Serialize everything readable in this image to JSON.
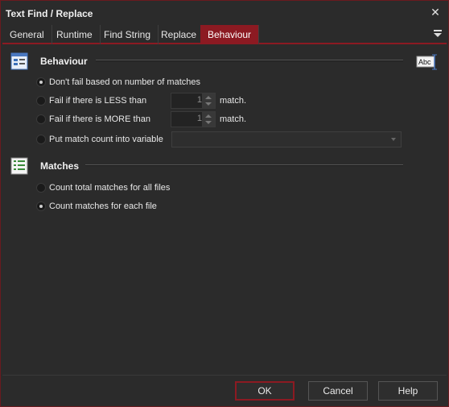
{
  "window": {
    "title": "Text Find / Replace"
  },
  "tabs": [
    {
      "label": "General"
    },
    {
      "label": "Runtime"
    },
    {
      "label": "Find String"
    },
    {
      "label": "Replace"
    },
    {
      "label": "Behaviour",
      "active": true
    }
  ],
  "behaviour": {
    "title": "Behaviour",
    "options": [
      {
        "label": "Don't fail based on number of matches",
        "checked": true
      },
      {
        "label": "Fail if there is LESS than",
        "checked": false
      },
      {
        "label": "Fail if there is MORE than",
        "checked": false
      },
      {
        "label": "Put match count into variable",
        "checked": false
      }
    ],
    "less_value": "1",
    "more_value": "1",
    "match_suffix": "match.",
    "variable_value": ""
  },
  "matches": {
    "title": "Matches",
    "options": [
      {
        "label": "Count total matches for all files",
        "checked": false
      },
      {
        "label": "Count matches for each file",
        "checked": true
      }
    ]
  },
  "buttons": {
    "ok": "OK",
    "cancel": "Cancel",
    "help": "Help"
  },
  "colors": {
    "accent": "#8c1a22",
    "background": "#2b2b2b"
  },
  "icons": {
    "close": "close-icon",
    "tab_menu": "tab-menu-icon",
    "behaviour": "behaviour-icon",
    "matches": "list-icon",
    "variable": "abc-text-icon"
  }
}
